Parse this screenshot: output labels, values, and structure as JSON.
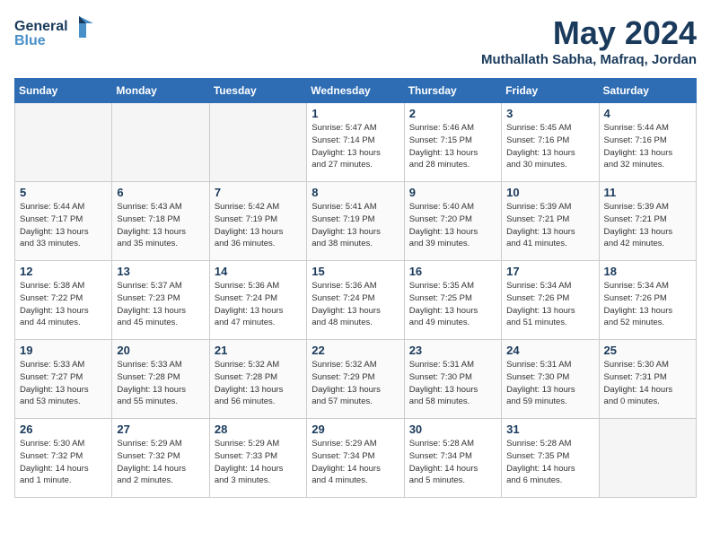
{
  "logo": {
    "general": "General",
    "blue": "Blue"
  },
  "title": "May 2024",
  "subtitle": "Muthallath Sabha, Mafraq, Jordan",
  "days_of_week": [
    "Sunday",
    "Monday",
    "Tuesday",
    "Wednesday",
    "Thursday",
    "Friday",
    "Saturday"
  ],
  "weeks": [
    [
      {
        "day": "",
        "info": ""
      },
      {
        "day": "",
        "info": ""
      },
      {
        "day": "",
        "info": ""
      },
      {
        "day": "1",
        "info": "Sunrise: 5:47 AM\nSunset: 7:14 PM\nDaylight: 13 hours\nand 27 minutes."
      },
      {
        "day": "2",
        "info": "Sunrise: 5:46 AM\nSunset: 7:15 PM\nDaylight: 13 hours\nand 28 minutes."
      },
      {
        "day": "3",
        "info": "Sunrise: 5:45 AM\nSunset: 7:16 PM\nDaylight: 13 hours\nand 30 minutes."
      },
      {
        "day": "4",
        "info": "Sunrise: 5:44 AM\nSunset: 7:16 PM\nDaylight: 13 hours\nand 32 minutes."
      }
    ],
    [
      {
        "day": "5",
        "info": "Sunrise: 5:44 AM\nSunset: 7:17 PM\nDaylight: 13 hours\nand 33 minutes."
      },
      {
        "day": "6",
        "info": "Sunrise: 5:43 AM\nSunset: 7:18 PM\nDaylight: 13 hours\nand 35 minutes."
      },
      {
        "day": "7",
        "info": "Sunrise: 5:42 AM\nSunset: 7:19 PM\nDaylight: 13 hours\nand 36 minutes."
      },
      {
        "day": "8",
        "info": "Sunrise: 5:41 AM\nSunset: 7:19 PM\nDaylight: 13 hours\nand 38 minutes."
      },
      {
        "day": "9",
        "info": "Sunrise: 5:40 AM\nSunset: 7:20 PM\nDaylight: 13 hours\nand 39 minutes."
      },
      {
        "day": "10",
        "info": "Sunrise: 5:39 AM\nSunset: 7:21 PM\nDaylight: 13 hours\nand 41 minutes."
      },
      {
        "day": "11",
        "info": "Sunrise: 5:39 AM\nSunset: 7:21 PM\nDaylight: 13 hours\nand 42 minutes."
      }
    ],
    [
      {
        "day": "12",
        "info": "Sunrise: 5:38 AM\nSunset: 7:22 PM\nDaylight: 13 hours\nand 44 minutes."
      },
      {
        "day": "13",
        "info": "Sunrise: 5:37 AM\nSunset: 7:23 PM\nDaylight: 13 hours\nand 45 minutes."
      },
      {
        "day": "14",
        "info": "Sunrise: 5:36 AM\nSunset: 7:24 PM\nDaylight: 13 hours\nand 47 minutes."
      },
      {
        "day": "15",
        "info": "Sunrise: 5:36 AM\nSunset: 7:24 PM\nDaylight: 13 hours\nand 48 minutes."
      },
      {
        "day": "16",
        "info": "Sunrise: 5:35 AM\nSunset: 7:25 PM\nDaylight: 13 hours\nand 49 minutes."
      },
      {
        "day": "17",
        "info": "Sunrise: 5:34 AM\nSunset: 7:26 PM\nDaylight: 13 hours\nand 51 minutes."
      },
      {
        "day": "18",
        "info": "Sunrise: 5:34 AM\nSunset: 7:26 PM\nDaylight: 13 hours\nand 52 minutes."
      }
    ],
    [
      {
        "day": "19",
        "info": "Sunrise: 5:33 AM\nSunset: 7:27 PM\nDaylight: 13 hours\nand 53 minutes."
      },
      {
        "day": "20",
        "info": "Sunrise: 5:33 AM\nSunset: 7:28 PM\nDaylight: 13 hours\nand 55 minutes."
      },
      {
        "day": "21",
        "info": "Sunrise: 5:32 AM\nSunset: 7:28 PM\nDaylight: 13 hours\nand 56 minutes."
      },
      {
        "day": "22",
        "info": "Sunrise: 5:32 AM\nSunset: 7:29 PM\nDaylight: 13 hours\nand 57 minutes."
      },
      {
        "day": "23",
        "info": "Sunrise: 5:31 AM\nSunset: 7:30 PM\nDaylight: 13 hours\nand 58 minutes."
      },
      {
        "day": "24",
        "info": "Sunrise: 5:31 AM\nSunset: 7:30 PM\nDaylight: 13 hours\nand 59 minutes."
      },
      {
        "day": "25",
        "info": "Sunrise: 5:30 AM\nSunset: 7:31 PM\nDaylight: 14 hours\nand 0 minutes."
      }
    ],
    [
      {
        "day": "26",
        "info": "Sunrise: 5:30 AM\nSunset: 7:32 PM\nDaylight: 14 hours\nand 1 minute."
      },
      {
        "day": "27",
        "info": "Sunrise: 5:29 AM\nSunset: 7:32 PM\nDaylight: 14 hours\nand 2 minutes."
      },
      {
        "day": "28",
        "info": "Sunrise: 5:29 AM\nSunset: 7:33 PM\nDaylight: 14 hours\nand 3 minutes."
      },
      {
        "day": "29",
        "info": "Sunrise: 5:29 AM\nSunset: 7:34 PM\nDaylight: 14 hours\nand 4 minutes."
      },
      {
        "day": "30",
        "info": "Sunrise: 5:28 AM\nSunset: 7:34 PM\nDaylight: 14 hours\nand 5 minutes."
      },
      {
        "day": "31",
        "info": "Sunrise: 5:28 AM\nSunset: 7:35 PM\nDaylight: 14 hours\nand 6 minutes."
      },
      {
        "day": "",
        "info": ""
      }
    ]
  ]
}
